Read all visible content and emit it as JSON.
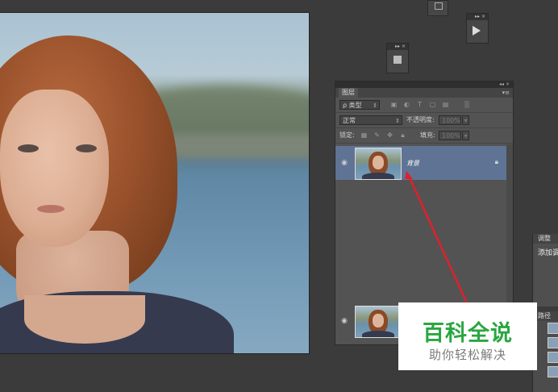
{
  "layers_panel": {
    "tab": "图层",
    "filter": {
      "kind_label": "ρ 类型",
      "arrow": "⇕"
    },
    "blend_mode": "正常",
    "opacity_label": "不透明度:",
    "opacity_value": "100%",
    "lock_label": "锁定:",
    "fill_label": "填充:",
    "fill_value": "100%",
    "layers": [
      {
        "name": "背景",
        "selected": true,
        "locked": true
      }
    ]
  },
  "adjustments_panel": {
    "tab": "调整",
    "hint": "添加调"
  },
  "paths_panel": {
    "tab": "路径"
  },
  "watermark": {
    "title": "百科全说",
    "subtitle": "助你轻松解决"
  },
  "icons": {
    "eye": "eye-icon",
    "lock": "lock-icon",
    "play": "play-icon",
    "brush": "brush-icon",
    "move": "move-icon",
    "transparency": "checker-icon"
  },
  "colors": {
    "selected_row": "#5f7494",
    "watermark_green": "#2aa640",
    "annotation_red": "#e0202a"
  }
}
